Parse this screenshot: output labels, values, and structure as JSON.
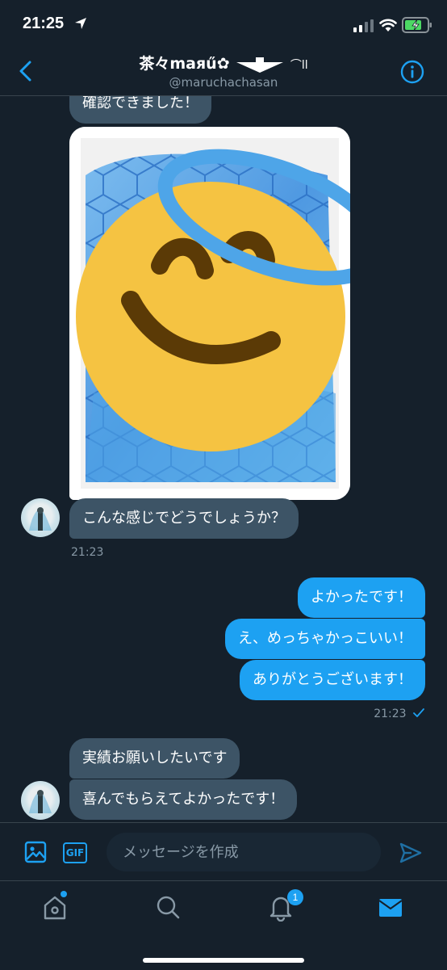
{
  "status_bar": {
    "time": "21:25"
  },
  "header": {
    "title": "茶々maяű✿",
    "title_suffix": "⌒ll",
    "handle": "@maruchachasan"
  },
  "messages": [
    {
      "id": "m1",
      "direction": "in",
      "text": "確認できました！"
    },
    {
      "id": "m2",
      "direction": "in",
      "type": "image",
      "text": ""
    },
    {
      "id": "m3",
      "direction": "in",
      "text": "こんな感じでどうでしょうか？"
    },
    {
      "id": "m4",
      "direction": "out",
      "text": "よかったです！"
    },
    {
      "id": "m5",
      "direction": "out",
      "text": "え、めっちゃかっこいい！"
    },
    {
      "id": "m6",
      "direction": "out",
      "text": "ありがとうございます！"
    },
    {
      "id": "m7",
      "direction": "in",
      "text": "実績お願いしたいです"
    },
    {
      "id": "m8",
      "direction": "in",
      "text": "喜んでもらえてよかったです！"
    }
  ],
  "timestamps": {
    "incoming": "21:23",
    "outgoing": "21:23"
  },
  "composer": {
    "placeholder": "メッセージを作成",
    "gif_label": "GIF"
  },
  "tabbar": {
    "notification_count": "1"
  },
  "colors": {
    "background": "#15202b",
    "accent": "#1da1f2",
    "incoming_bubble": "#3d5466",
    "muted_text": "#8899a6",
    "emoji_face": "#f5c342"
  },
  "icons": [
    "location-arrow-icon",
    "signal-icon",
    "wifi-icon",
    "battery-icon",
    "back-chevron-icon",
    "info-icon",
    "read-check-icon",
    "image-icon",
    "send-icon",
    "home-icon",
    "search-icon",
    "bell-icon",
    "mail-icon"
  ]
}
